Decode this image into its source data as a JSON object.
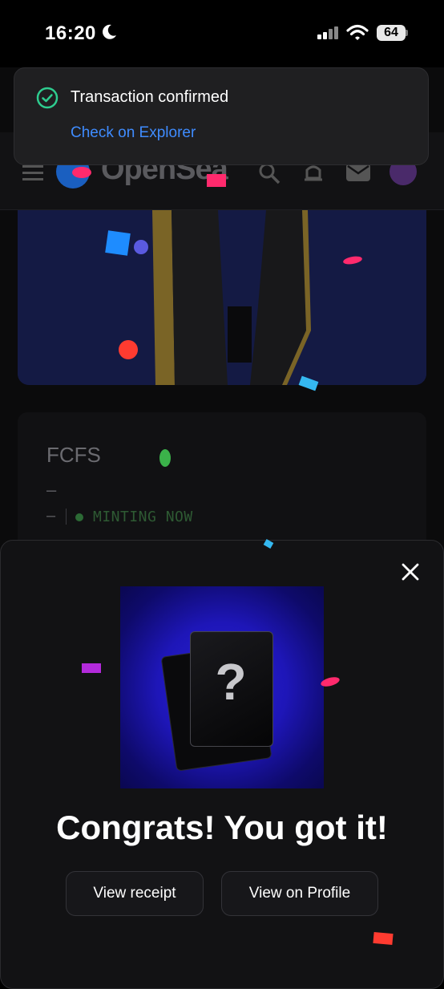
{
  "status_bar": {
    "time": "16:20",
    "battery": "64"
  },
  "app": {
    "brand": "OpenSea",
    "mint_section": {
      "title": "FCFS",
      "line1": "–",
      "line2": "–",
      "status": "MINTING NOW"
    }
  },
  "toast": {
    "title": "Transaction confirmed",
    "link": "Check on Explorer"
  },
  "modal": {
    "question_mark": "?",
    "heading": "Congrats! You got it!",
    "buttons": {
      "receipt": "View receipt",
      "profile": "View on Profile"
    }
  },
  "colors": {
    "accent_link": "#3f8cff",
    "success": "#2ecc8f",
    "reveal_bg": "#2a22d8"
  }
}
